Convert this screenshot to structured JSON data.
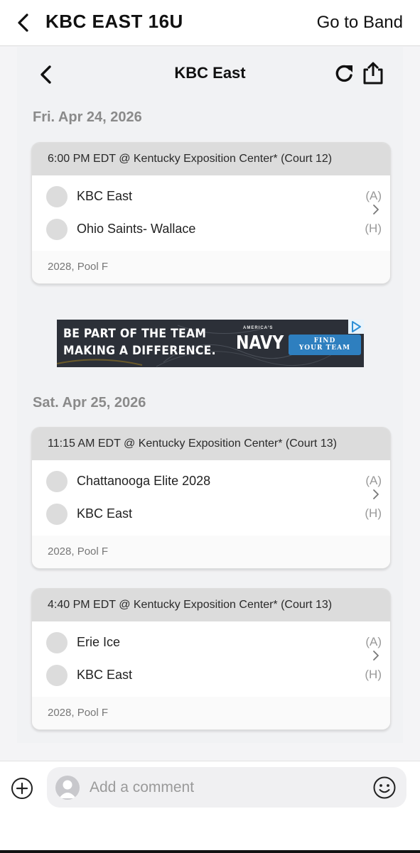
{
  "topbar": {
    "title": "KBC EAST 16U",
    "go_band": "Go to Band"
  },
  "web": {
    "title": "KBC East",
    "days": [
      {
        "date": "Fri. Apr 24, 2026",
        "games": [
          {
            "header": "6:00 PM EDT @ Kentucky Exposition Center* (Court 12)",
            "teams": [
              {
                "name": "KBC East",
                "side": "(A)"
              },
              {
                "name": "Ohio Saints- Wallace",
                "side": "(H)"
              }
            ],
            "footer": "2028, Pool F"
          }
        ]
      },
      {
        "date": "Sat. Apr 25, 2026",
        "games": [
          {
            "header": "11:15 AM EDT @ Kentucky Exposition Center* (Court 13)",
            "teams": [
              {
                "name": "Chattanooga Elite 2028",
                "side": "(A)"
              },
              {
                "name": "KBC East",
                "side": "(H)"
              }
            ],
            "footer": "2028, Pool F"
          },
          {
            "header": "4:40 PM EDT @ Kentucky Exposition Center* (Court 13)",
            "teams": [
              {
                "name": "Erie Ice",
                "side": "(A)"
              },
              {
                "name": "KBC East",
                "side": "(H)"
              }
            ],
            "footer": "2028, Pool F"
          }
        ]
      }
    ]
  },
  "ad": {
    "line1": "BE PART OF THE TEAM",
    "line2": "MAKING A DIFFERENCE.",
    "brand_small": "AMERICA'S",
    "brand": "NAVY",
    "cta_line1": "FIND",
    "cta_line2": "YOUR TEAM"
  },
  "comment": {
    "placeholder": "Add a comment"
  },
  "icons": {
    "back": "chevron-left-icon",
    "refresh": "refresh-icon",
    "share": "share-icon",
    "chevron": "chevron-right-icon",
    "add": "plus-circle-icon",
    "emoji": "smiley-icon",
    "avatar": "user-avatar-icon"
  },
  "colors": {
    "card_header": "#dcdcdc",
    "cta": "#2e7fbf",
    "date_text": "#8a8a8a"
  }
}
